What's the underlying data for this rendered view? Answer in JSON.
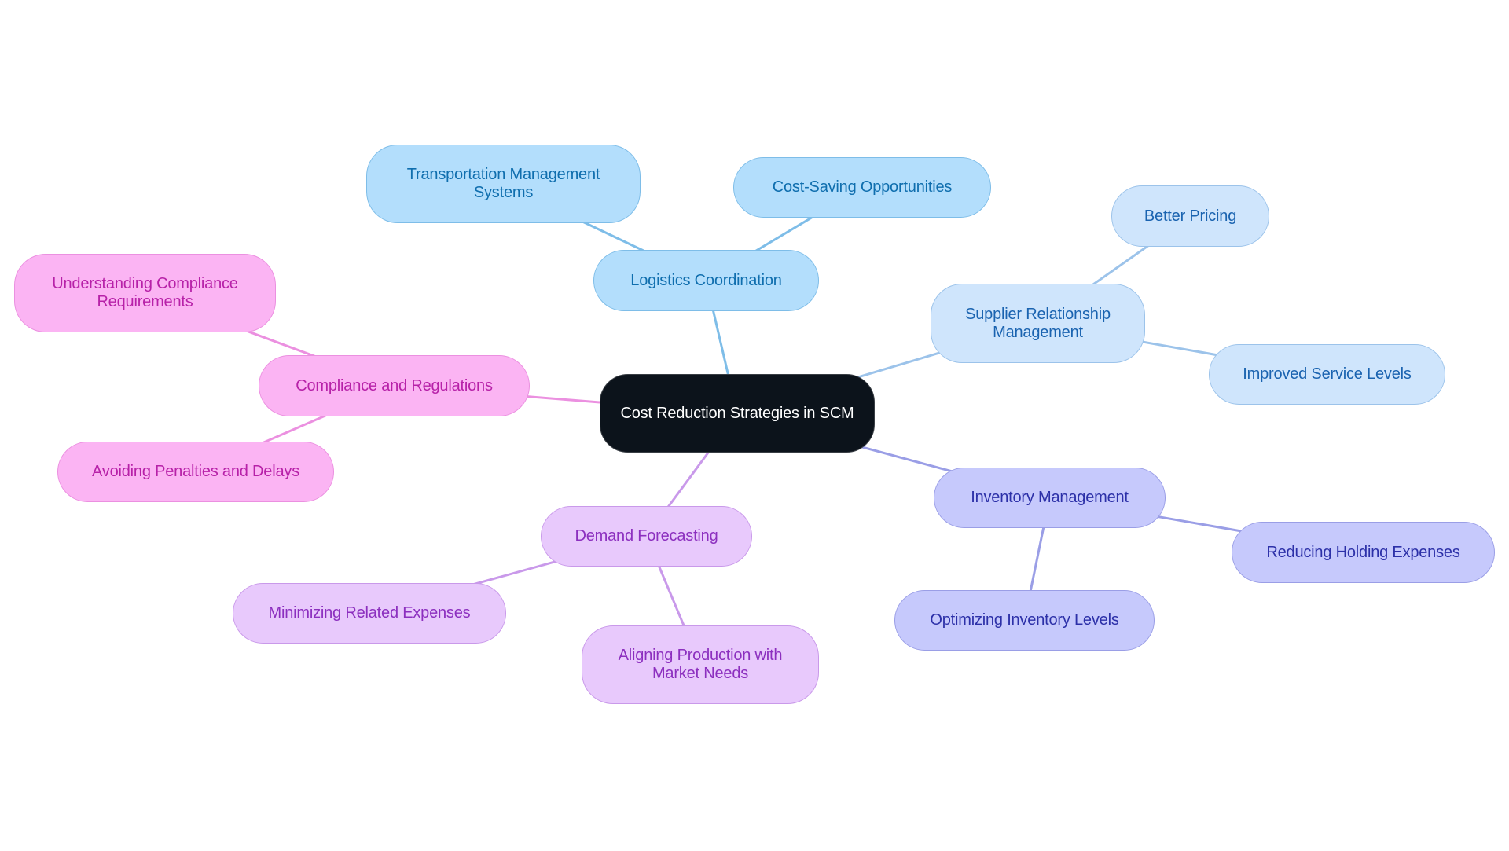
{
  "diagram": {
    "type": "mindmap",
    "root": {
      "id": "root",
      "label": "Cost Reduction Strategies in SCM",
      "theme": "root"
    },
    "branches": [
      {
        "id": "logistics",
        "label": "Logistics Coordination",
        "theme": "blue",
        "edge_color": "#7ebde8",
        "children": [
          {
            "id": "transportation",
            "label": "Transportation Management Systems"
          },
          {
            "id": "cost-saving",
            "label": "Cost-Saving Opportunities"
          }
        ]
      },
      {
        "id": "supplier",
        "label": "Supplier Relationship Management",
        "theme": "lblue",
        "edge_color": "#9cc3ea",
        "children": [
          {
            "id": "better-pricing",
            "label": "Better Pricing"
          },
          {
            "id": "improved-service",
            "label": "Improved Service Levels"
          }
        ]
      },
      {
        "id": "inventory",
        "label": "Inventory Management",
        "theme": "indigo",
        "edge_color": "#9a9ee6",
        "children": [
          {
            "id": "reducing-holding",
            "label": "Reducing Holding Expenses"
          },
          {
            "id": "optimizing-inventory",
            "label": "Optimizing Inventory Levels"
          }
        ]
      },
      {
        "id": "demand",
        "label": "Demand Forecasting",
        "theme": "purple",
        "edge_color": "#c999ea",
        "children": [
          {
            "id": "minimizing",
            "label": "Minimizing Related Expenses"
          },
          {
            "id": "aligning",
            "label": "Aligning Production with Market Needs"
          }
        ]
      },
      {
        "id": "compliance",
        "label": "Compliance and Regulations",
        "theme": "pink",
        "edge_color": "#eb90e0",
        "children": [
          {
            "id": "understanding",
            "label": "Understanding Compliance Requirements"
          },
          {
            "id": "avoiding",
            "label": "Avoiding Penalties and Delays"
          }
        ]
      }
    ]
  },
  "colors": {
    "root_bg": "#0c131b",
    "blue": "#b3defc",
    "light_blue": "#cfe5fc",
    "indigo": "#c6c9fc",
    "purple": "#e8c9fc",
    "pink": "#fbb4f3"
  }
}
